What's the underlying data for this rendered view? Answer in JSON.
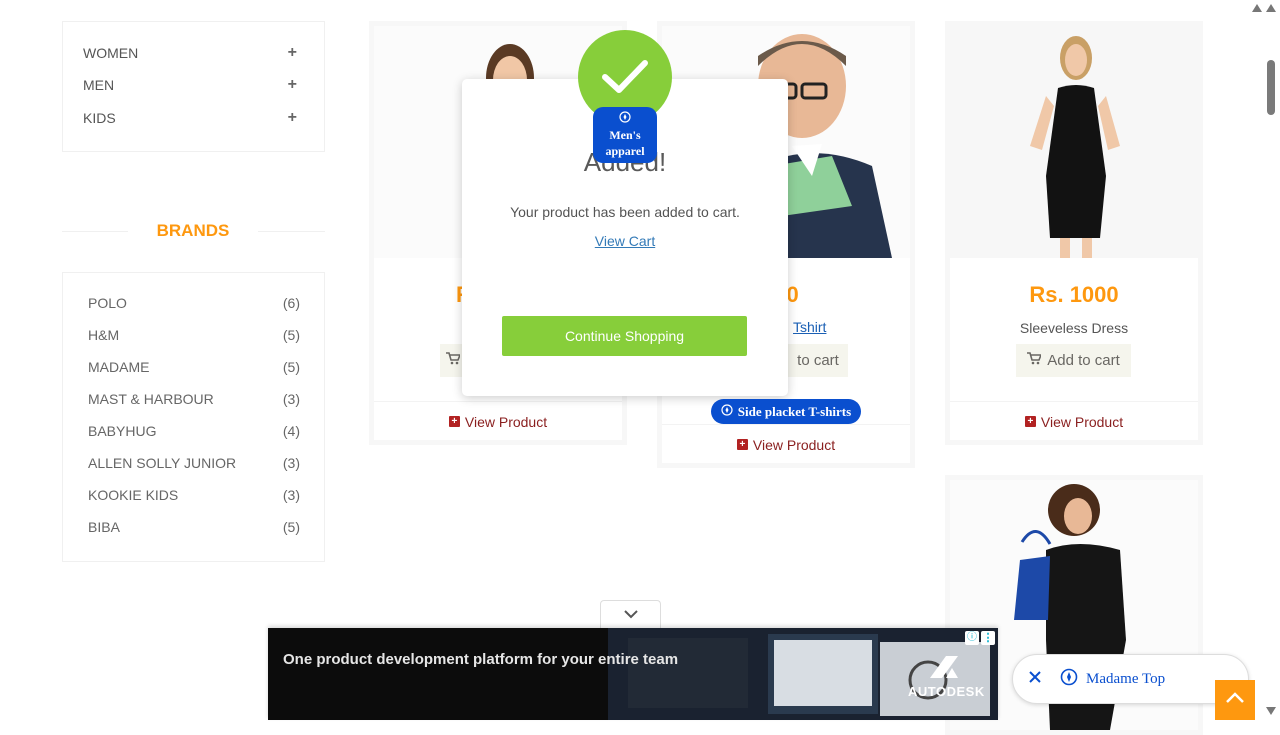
{
  "sidebar": {
    "categories": [
      {
        "label": "WOMEN",
        "toggle": "+"
      },
      {
        "label": "MEN",
        "toggle": "+"
      },
      {
        "label": "KIDS",
        "toggle": "+"
      }
    ],
    "brands_title": "BRANDS",
    "brands": [
      {
        "name": "POLO",
        "count": "(6)"
      },
      {
        "name": "H&M",
        "count": "(5)"
      },
      {
        "name": "MADAME",
        "count": "(5)"
      },
      {
        "name": "MAST & HARBOUR",
        "count": "(3)"
      },
      {
        "name": "BABYHUG",
        "count": "(4)"
      },
      {
        "name": "ALLEN SOLLY JUNIOR",
        "count": "(3)"
      },
      {
        "name": "KOOKIE KIDS",
        "count": "(3)"
      },
      {
        "name": "BIBA",
        "count": "(5)"
      }
    ]
  },
  "products": [
    {
      "price": "R",
      "view_label": "View Product"
    },
    {
      "price": "400",
      "name": "Tshirt",
      "add_label": "to cart",
      "view_label": "View Product"
    },
    {
      "price": "Rs. 1000",
      "name": "Sleeveless Dress",
      "add_label": "Add to cart",
      "view_label": "View Product"
    }
  ],
  "modal": {
    "title": "Added!",
    "message": "Your product has been added to cart.",
    "view_cart": "View Cart",
    "continue": "Continue Shopping"
  },
  "chips": {
    "mens_apparel_line1": "Men's",
    "mens_apparel_line2": "apparel",
    "side_placket": "Side placket T-shirts",
    "madame_top": "Madame Top"
  },
  "ad": {
    "headline": "One product development platform for your entire team",
    "brand": "AUTODESK"
  },
  "colors": {
    "accent": "#fe980f",
    "success": "#87ce3a",
    "chip": "#0a4fcf",
    "view_product": "#8a1f1f"
  }
}
